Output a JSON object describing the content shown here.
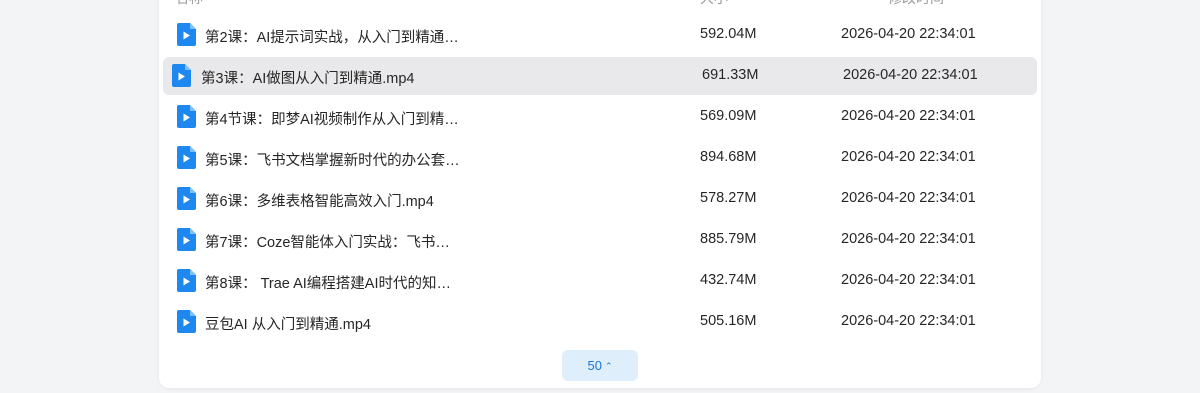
{
  "columns": {
    "name": "名称",
    "size": "大小",
    "modified": "修改时间"
  },
  "files": [
    {
      "name": "第2课：AI提示词实战，从入门到精通…",
      "size": "592.04M",
      "modified": "2026-04-20 22:34:01",
      "selected": false
    },
    {
      "name": "第3课：AI做图从入门到精通.mp4",
      "size": "691.33M",
      "modified": "2026-04-20 22:34:01",
      "selected": true
    },
    {
      "name": "第4节课：即梦AI视频制作从入门到精…",
      "size": "569.09M",
      "modified": "2026-04-20 22:34:01",
      "selected": false
    },
    {
      "name": "第5课：飞书文档掌握新时代的办公套…",
      "size": "894.68M",
      "modified": "2026-04-20 22:34:01",
      "selected": false
    },
    {
      "name": "第6课：多维表格智能高效入门.mp4",
      "size": "578.27M",
      "modified": "2026-04-20 22:34:01",
      "selected": false
    },
    {
      "name": "第7课：Coze智能体入门实战：飞书…",
      "size": "885.79M",
      "modified": "2026-04-20 22:34:01",
      "selected": false
    },
    {
      "name": "第8课： Trae AI编程搭建AI时代的知…",
      "size": "432.74M",
      "modified": "2026-04-20 22:34:01",
      "selected": false
    },
    {
      "name": "豆包AI 从入门到精通.mp4",
      "size": "505.16M",
      "modified": "2026-04-20 22:34:01",
      "selected": false
    }
  ],
  "pagination": {
    "page_size": "50",
    "icon": "chevron-up-down-icon"
  },
  "colors": {
    "file_icon": "#1e88f0",
    "selected_row": "#e9e9eb",
    "pager_bg": "#dfeefb",
    "pager_text": "#1677d6"
  }
}
